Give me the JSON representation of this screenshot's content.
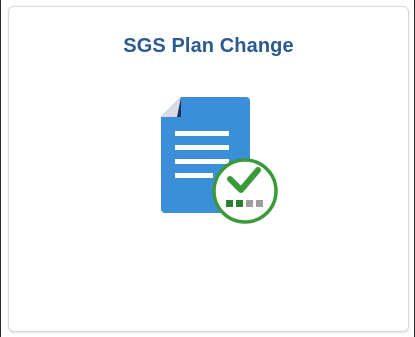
{
  "tile": {
    "title": "SGS Plan Change",
    "icon": "document-approved-icon"
  },
  "colors": {
    "title": "#2a5a8f",
    "document": "#3b8fd9",
    "document_fold": "#1d2f5c",
    "check_circle": "#3a9a3a",
    "tile_border": "#d7d7d7"
  }
}
